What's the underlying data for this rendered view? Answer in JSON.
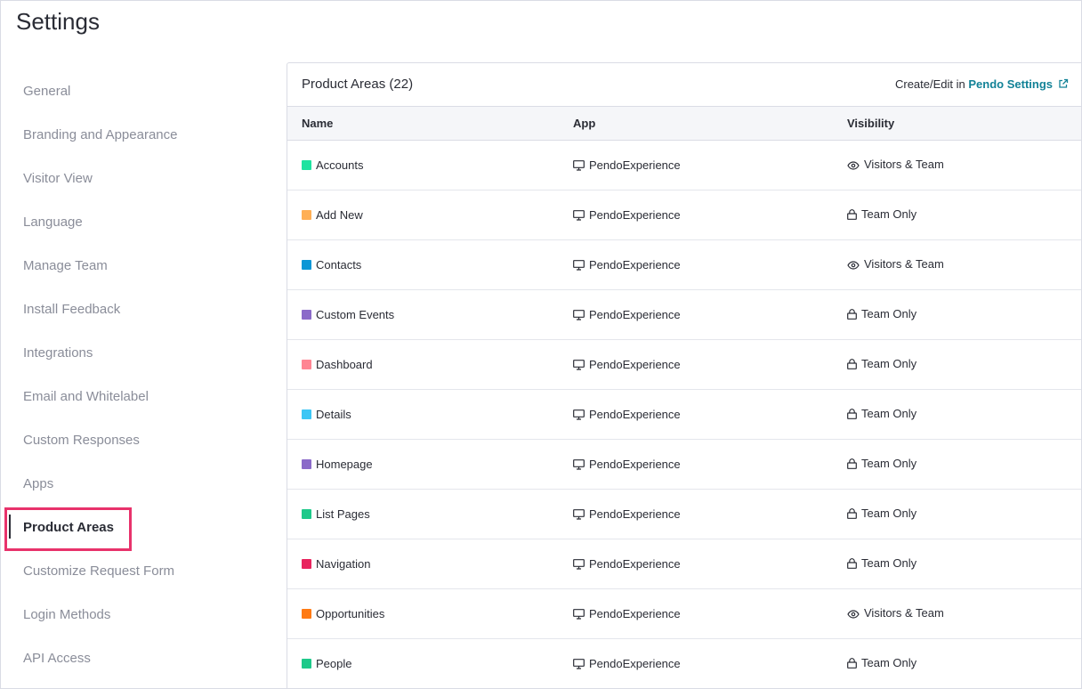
{
  "page": {
    "title": "Settings"
  },
  "sidebar": {
    "items": [
      {
        "label": "General",
        "active": false
      },
      {
        "label": "Branding and Appearance",
        "active": false
      },
      {
        "label": "Visitor View",
        "active": false
      },
      {
        "label": "Language",
        "active": false
      },
      {
        "label": "Manage Team",
        "active": false
      },
      {
        "label": "Install Feedback",
        "active": false
      },
      {
        "label": "Integrations",
        "active": false
      },
      {
        "label": "Email and Whitelabel",
        "active": false
      },
      {
        "label": "Custom Responses",
        "active": false
      },
      {
        "label": "Apps",
        "active": false
      },
      {
        "label": "Product Areas",
        "active": true
      },
      {
        "label": "Customize Request Form",
        "active": false
      },
      {
        "label": "Login Methods",
        "active": false
      },
      {
        "label": "API Access",
        "active": false
      }
    ]
  },
  "panel": {
    "title": "Product Areas (22)",
    "link_prefix": "Create/Edit in",
    "link_label": "Pendo Settings",
    "link_icon": "external-link-icon",
    "accent_color": "#128297"
  },
  "table": {
    "columns": [
      "Name",
      "App",
      "Visibility"
    ],
    "rows": [
      {
        "name": "Accounts",
        "color": "#1ee3a0",
        "app": "PendoExperience",
        "app_icon": "monitor-icon",
        "visibility": "Visitors & Team",
        "vis_icon": "eye-icon"
      },
      {
        "name": "Add New",
        "color": "#ffaf55",
        "app": "PendoExperience",
        "app_icon": "monitor-icon",
        "visibility": "Team Only",
        "vis_icon": "lock-icon"
      },
      {
        "name": "Contacts",
        "color": "#0b96d6",
        "app": "PendoExperience",
        "app_icon": "monitor-icon",
        "visibility": "Visitors & Team",
        "vis_icon": "eye-icon"
      },
      {
        "name": "Custom Events",
        "color": "#8b6ac9",
        "app": "PendoExperience",
        "app_icon": "monitor-icon",
        "visibility": "Team Only",
        "vis_icon": "lock-icon"
      },
      {
        "name": "Dashboard",
        "color": "#ff8593",
        "app": "PendoExperience",
        "app_icon": "monitor-icon",
        "visibility": "Team Only",
        "vis_icon": "lock-icon"
      },
      {
        "name": "Details",
        "color": "#3cc6f5",
        "app": "PendoExperience",
        "app_icon": "monitor-icon",
        "visibility": "Team Only",
        "vis_icon": "lock-icon"
      },
      {
        "name": "Homepage",
        "color": "#8b6ac9",
        "app": "PendoExperience",
        "app_icon": "monitor-icon",
        "visibility": "Team Only",
        "vis_icon": "lock-icon"
      },
      {
        "name": "List Pages",
        "color": "#1ec98a",
        "app": "PendoExperience",
        "app_icon": "monitor-icon",
        "visibility": "Team Only",
        "vis_icon": "lock-icon"
      },
      {
        "name": "Navigation",
        "color": "#e8245e",
        "app": "PendoExperience",
        "app_icon": "monitor-icon",
        "visibility": "Team Only",
        "vis_icon": "lock-icon"
      },
      {
        "name": "Opportunities",
        "color": "#ff7a14",
        "app": "PendoExperience",
        "app_icon": "monitor-icon",
        "visibility": "Visitors & Team",
        "vis_icon": "eye-icon"
      },
      {
        "name": "People",
        "color": "#1ec98a",
        "app": "PendoExperience",
        "app_icon": "monitor-icon",
        "visibility": "Team Only",
        "vis_icon": "lock-icon"
      }
    ]
  }
}
